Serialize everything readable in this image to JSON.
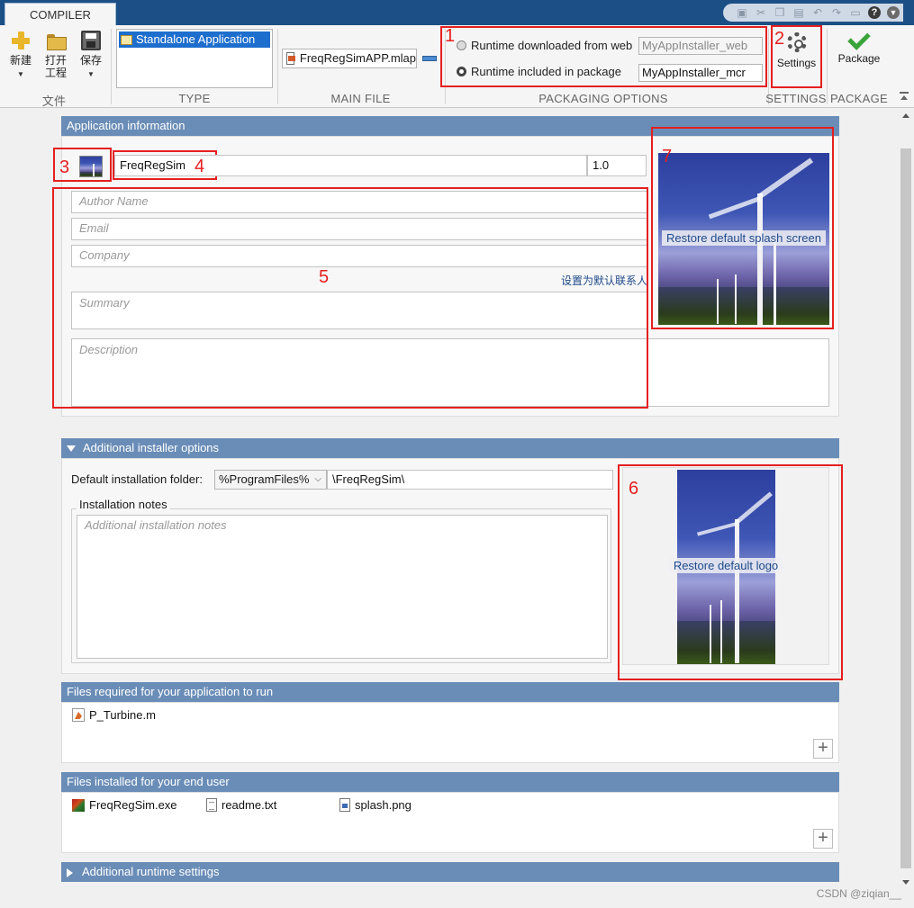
{
  "window": {
    "tab": "COMPILER"
  },
  "ribbon": {
    "file_group": {
      "new_label": "新建",
      "open_label_line1": "打开",
      "open_label_line2": "工程",
      "save_label": "保存",
      "section": "文件"
    },
    "type": {
      "section": "TYPE",
      "selected": "Standalone Application"
    },
    "main_file": {
      "section": "MAIN FILE",
      "value": "FreqRegSimAPP.mlap"
    },
    "packaging_options": {
      "section": "PACKAGING OPTIONS",
      "option_web_label": "Runtime downloaded from web",
      "option_web_value": "MyAppInstaller_web",
      "option_mcr_label": "Runtime included in package",
      "option_mcr_value": "MyAppInstaller_mcr",
      "selected": "mcr"
    },
    "settings": {
      "section": "SETTINGS",
      "button_label": "Settings"
    },
    "package": {
      "section": "PACKAGE",
      "button_label": "Package"
    }
  },
  "annotations": [
    "1",
    "2",
    "3",
    "4",
    "5",
    "6",
    "7"
  ],
  "app_info": {
    "header": "Application information",
    "app_name": "FreqRegSim",
    "version": "1.0",
    "author_placeholder": "Author Name",
    "email_placeholder": "Email",
    "company_placeholder": "Company",
    "set_default_contact": "设置为默认联系人",
    "summary_placeholder": "Summary",
    "description_placeholder": "Description",
    "splash_label": "Restore default splash screen"
  },
  "installer": {
    "header": "Additional installer options",
    "default_folder_label": "Default installation folder:",
    "folder_root": "%ProgramFiles%",
    "folder_path": "\\FreqRegSim\\",
    "notes_label": "Installation notes",
    "notes_placeholder": "Additional installation notes",
    "logo_label": "Restore default logo"
  },
  "files_required": {
    "header": "Files required for your application to run",
    "files": [
      "P_Turbine.m"
    ]
  },
  "files_installed": {
    "header": "Files installed for your end user",
    "files": [
      "FreqRegSim.exe",
      "readme.txt",
      "splash.png"
    ]
  },
  "runtime_settings": {
    "header": "Additional runtime settings"
  },
  "watermark": "CSDN @ziqian__",
  "colors": {
    "title_bar": "#1c4f85",
    "section_header": "#6a8db7",
    "annotation_red": "#e51f1f",
    "selection_blue": "#1e6ecd"
  }
}
